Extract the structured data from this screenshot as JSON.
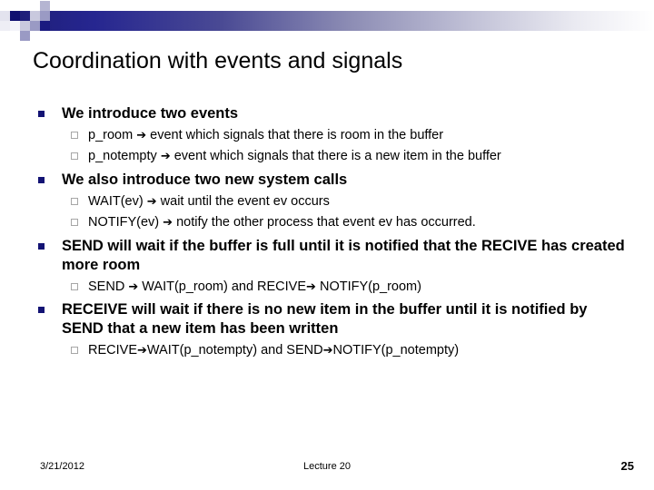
{
  "slide": {
    "title": "Coordination with events and signals",
    "colors": {
      "bullet_navy": "#131374",
      "gradient_start": "#1e1e78",
      "gradient_end": "#ffffff",
      "sub_bullet_outline": "#a6a6a6",
      "text": "#000000"
    },
    "arrow_glyph": "➔",
    "sections": [
      {
        "heading": "We introduce two events",
        "sub": [
          {
            "before": "p_room ",
            "after": " event which signals that there is room in the buffer"
          },
          {
            "before": "p_notempty ",
            "after": " event which signals that there is a new item in the buffer"
          }
        ]
      },
      {
        "heading": "We also introduce two new system calls",
        "sub": [
          {
            "before": "WAIT(ev) ",
            "after": " wait until the event ev occurs"
          },
          {
            "before": "NOTIFY(ev) ",
            "after": " notify the other process that event ev has occurred."
          }
        ]
      },
      {
        "heading": "SEND will wait if the buffer is full until it is notified that the RECIVE has created more room",
        "sub": [
          {
            "before": "SEND ",
            "mid": " WAIT(p_room) and RECIVE",
            "after": " NOTIFY(p_room)"
          }
        ]
      },
      {
        "heading": "RECEIVE will wait if there is no new item in the buffer until it is notified by SEND that a new item has been written",
        "sub": [
          {
            "before": "RECIVE",
            "mid": "WAIT(p_notempty) and SEND",
            "after": "NOTIFY(p_notempty)"
          }
        ]
      }
    ]
  },
  "footer": {
    "date": "3/21/2012",
    "lecture": "Lecture 20",
    "page": "25"
  }
}
